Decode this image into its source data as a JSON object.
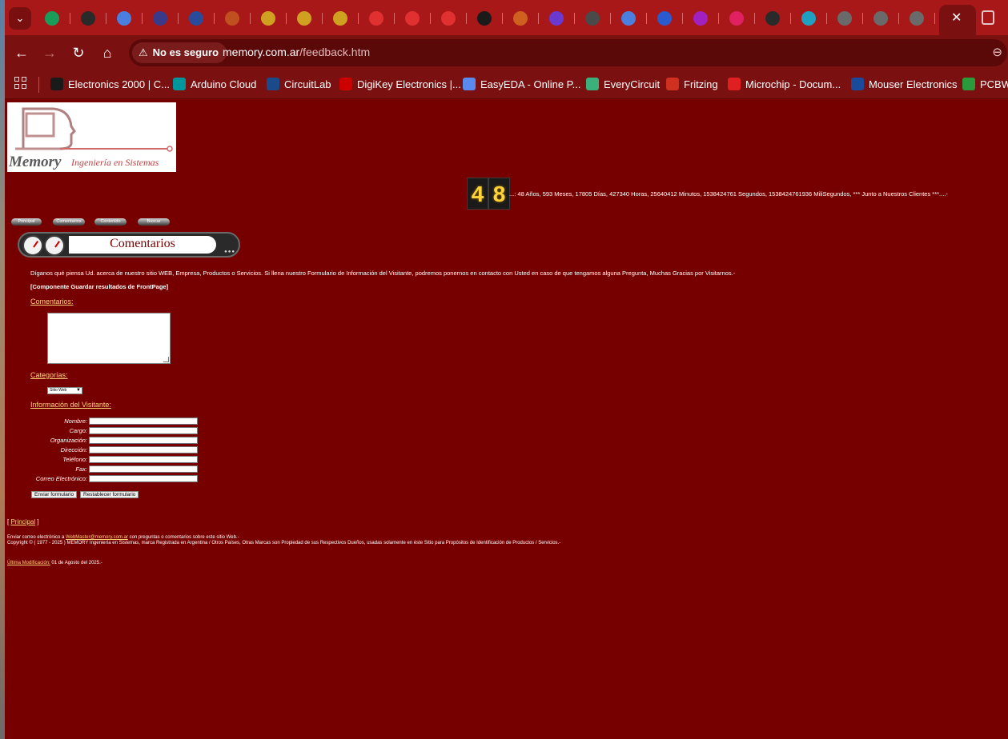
{
  "browser": {
    "active_tab_close": "✕",
    "security_label": "No es seguro",
    "url_domain": "memory.com.ar",
    "url_path": "/feedback.htm",
    "tab_favicon_colors": [
      "#1a9c5a",
      "#2a2a2a",
      "#4a7fe0",
      "#3a3a8a",
      "#2a4a9a",
      "#c05020",
      "#d0a020",
      "#d0a020",
      "#d0a020",
      "#e03030",
      "#e03030",
      "#e03030",
      "#1a1a1a",
      "#d06020",
      "#6a3ad0",
      "#4a4a4a",
      "#4a7fe0",
      "#2a5ad0",
      "#a020c0",
      "#e02060",
      "#2a2a2a",
      "#20a0c0",
      "#6a6a6a",
      "#6a6a6a",
      "#6a6a6a"
    ],
    "bookmarks": [
      {
        "label": "Electronics 2000 | C...",
        "color": "#1a1a1a"
      },
      {
        "label": "Arduino Cloud",
        "color": "#00979c"
      },
      {
        "label": "CircuitLab",
        "color": "#1a4a8a"
      },
      {
        "label": "DigiKey Electronics |...",
        "color": "#cc0000"
      },
      {
        "label": "EasyEDA - Online P...",
        "color": "#5a8af0"
      },
      {
        "label": "EveryCircuit",
        "color": "#3ab07a"
      },
      {
        "label": "Fritzing",
        "color": "#d03020"
      },
      {
        "label": "Microchip - Docum...",
        "color": "#e02020"
      },
      {
        "label": "Mouser Electronics",
        "color": "#1a4a9a"
      },
      {
        "label": "PCBWa",
        "color": "#2a9a3a"
      }
    ]
  },
  "site": {
    "logo_word": "Memory",
    "logo_sub": "Ingeniería en Sistemas",
    "counter_digits": [
      "4",
      "8"
    ],
    "counter_text": "...: 48 Años, 593 Meses, 17805 Días, 427340 Horas, 25640412 Minutos, 1538424761 Segundos, 1538424761936 MiliSegundos, *** Junto a Nuestros Clientes ***....-",
    "nav": [
      "Principal",
      "Comentarios",
      "Contenido",
      "Buscar"
    ],
    "banner_title": "Comentarios",
    "intro": "Díganos qué piensa Ud. acerca de nuestro sitio WEB, Empresa, Productos o Servicios. Si llena nuestro Formulario de Información del Visitante, podremos ponernos en contacto con Usted en caso de que tengamos alguna Pregunta, Muchas Gracias por Visitarnos.-",
    "frontpage_note": "[Componente Guardar resultados de FrontPage]",
    "comments_label": "Comentarios:",
    "categories_label": "Categorías:",
    "category_selected": "Sitio Web",
    "visitor_label": "Información del Visitante:",
    "fields": [
      "Nombre:",
      "Cargo:",
      "Organización:",
      "Dirección:",
      "Teléfono:",
      "Fax:",
      "Correo Electrónico:"
    ],
    "submit_label": "Enviar formulario",
    "reset_label": "Restablecer formulario",
    "principal_link": "Principal",
    "footer_email_pre": "Enviar correo electrónico a ",
    "footer_email_link": "WebMaster@memory.com.ar",
    "footer_email_post": " con preguntas o comentarios sobre este sitio Web.-",
    "copyright": "Copyright © ( 1977 - 2025 ) MEMORY Ingeniería en Sistemas, marca Registrada en Argentina / Otros Países, Otras Marcas son Propiedad de sus Respectivos Dueños, usadas solamente en éste Sitio para Propósitos de Identificación de Productos / Servicios.-",
    "last_mod_label": "Última Modificación:",
    "last_mod_date": " 01 de Agosto del 2025.-"
  }
}
